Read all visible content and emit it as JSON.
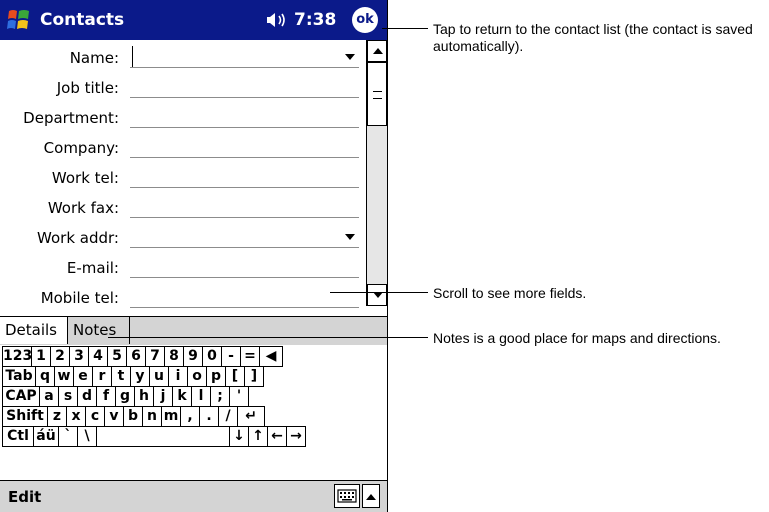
{
  "title_bar": {
    "app_title": "Contacts",
    "time": "7:38",
    "ok_label": "ok"
  },
  "form": {
    "fields": [
      {
        "label": "Name:",
        "value": "",
        "has_dropdown": true
      },
      {
        "label": "Job title:",
        "value": ""
      },
      {
        "label": "Department:",
        "value": ""
      },
      {
        "label": "Company:",
        "value": ""
      },
      {
        "label": "Work tel:",
        "value": ""
      },
      {
        "label": "Work fax:",
        "value": ""
      },
      {
        "label": "Work addr:",
        "value": "",
        "has_dropdown": true
      },
      {
        "label": "E-mail:",
        "value": ""
      },
      {
        "label": "Mobile tel:",
        "value": ""
      }
    ]
  },
  "tabs": [
    {
      "label": "Details",
      "selected": true
    },
    {
      "label": "Notes",
      "selected": false
    }
  ],
  "keyboard": {
    "rows": [
      [
        "123",
        "1",
        "2",
        "3",
        "4",
        "5",
        "6",
        "7",
        "8",
        "9",
        "0",
        "-",
        "=",
        "◀"
      ],
      [
        "Tab",
        "q",
        "w",
        "e",
        "r",
        "t",
        "y",
        "u",
        "i",
        "o",
        "p",
        "[",
        "]"
      ],
      [
        "CAP",
        "a",
        "s",
        "d",
        "f",
        "g",
        "h",
        "j",
        "k",
        "l",
        ";",
        "'"
      ],
      [
        "Shift",
        "z",
        "x",
        "c",
        "v",
        "b",
        "n",
        "m",
        ",",
        ".",
        "/",
        "↵"
      ],
      [
        "Ctl",
        "áü",
        "`",
        "\\",
        "",
        "↓",
        "↑",
        "←",
        "→"
      ]
    ]
  },
  "bottom_bar": {
    "menu": "Edit"
  },
  "callouts": [
    "Tap to return to the contact list (the contact is saved automatically).",
    "Scroll to see more fields.",
    "Notes is a good place for maps and directions."
  ],
  "colors": {
    "title_bar": "#0b1a8a",
    "chrome": "#d4d4d4"
  }
}
